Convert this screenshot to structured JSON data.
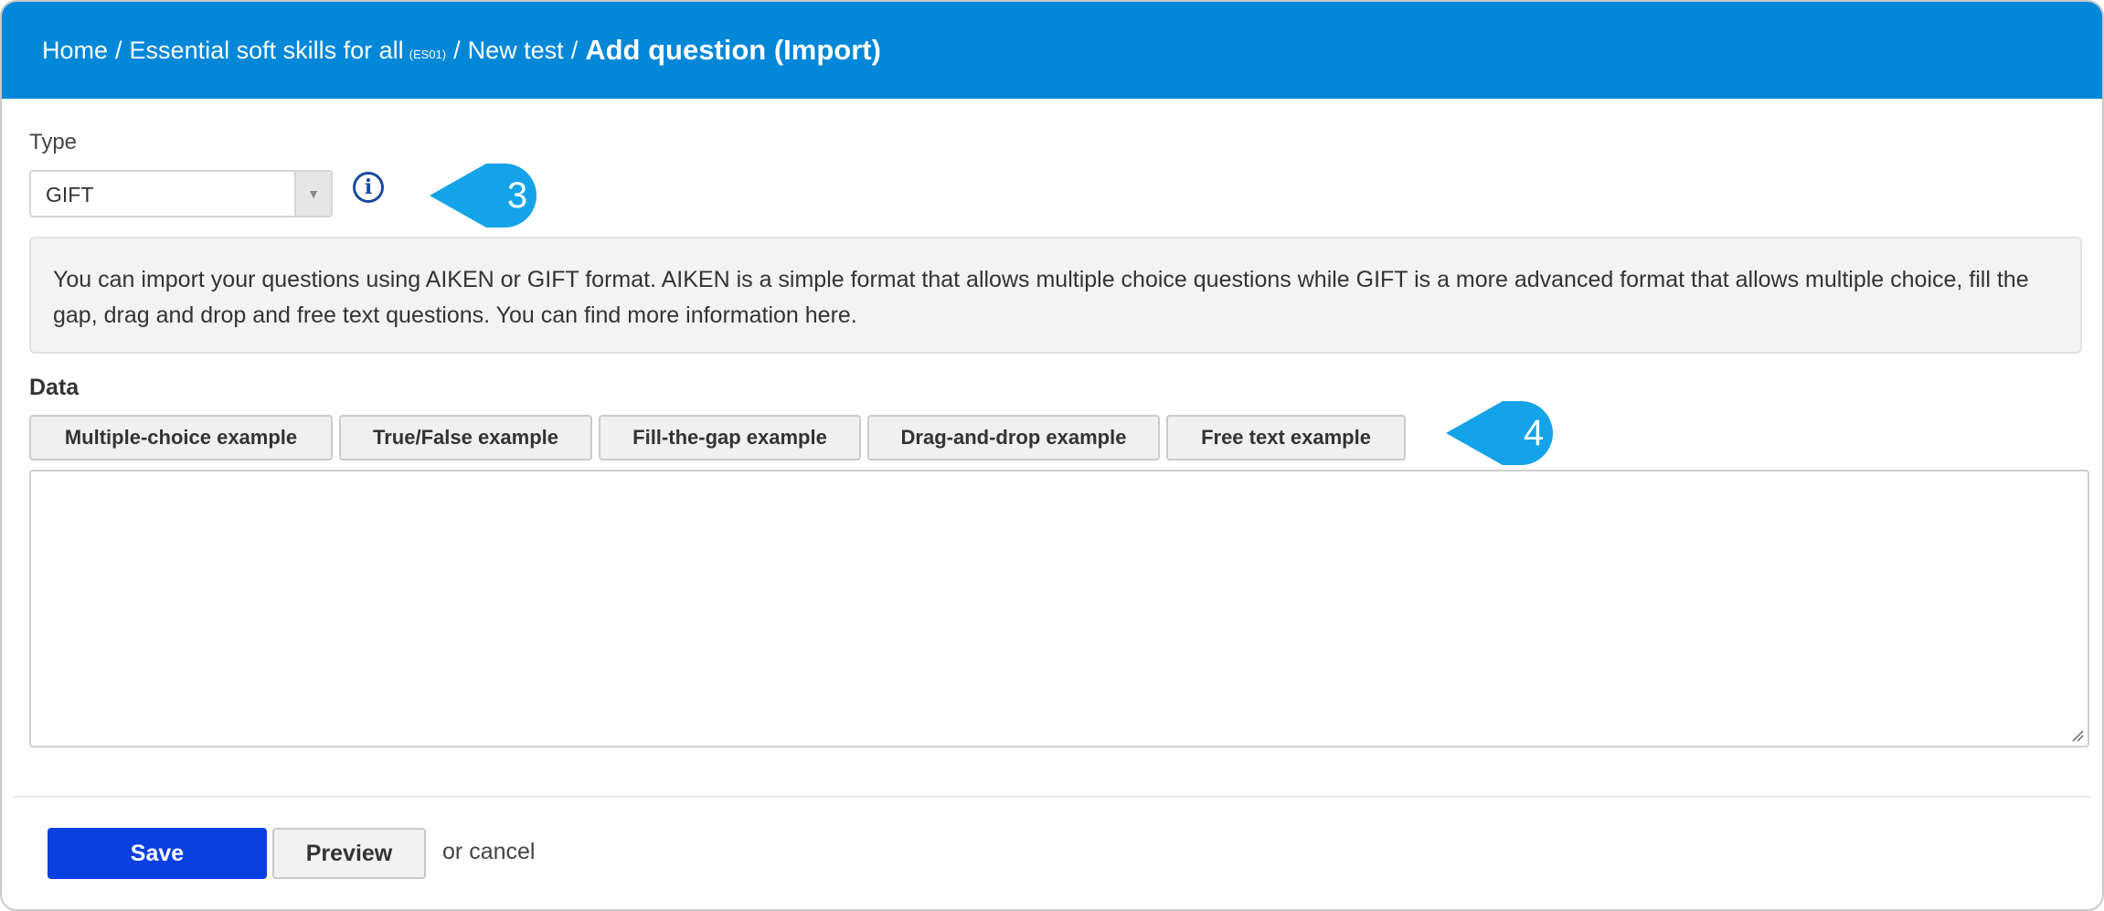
{
  "breadcrumb": {
    "home": "Home",
    "course": "Essential soft skills for all",
    "course_code": "(ES01)",
    "test": "New test",
    "current": "Add question (Import)"
  },
  "type_field": {
    "label": "Type",
    "selected": "GIFT"
  },
  "callouts": {
    "type": "3",
    "examples": "4"
  },
  "info_text": "You can import your questions using AIKEN or GIFT format. AIKEN is a simple format that allows multiple choice questions while GIFT is a more advanced format that allows multiple choice, fill the gap, drag and drop and free text questions. You can find more information here.",
  "data_field": {
    "label": "Data",
    "examples": [
      "Multiple-choice example",
      "True/False example",
      "Fill-the-gap example",
      "Drag-and-drop example",
      "Free text example"
    ],
    "value": ""
  },
  "actions": {
    "save": "Save",
    "preview": "Preview",
    "or": "or",
    "cancel": "cancel"
  },
  "colors": {
    "header_bg": "#0087d8",
    "callout": "#14a3e8",
    "save_bg": "#0a3fe0",
    "info_icon": "#1a4a9c"
  },
  "icons": {
    "info": "info-circle-icon",
    "dropdown": "caret-down-icon",
    "resize": "resize-grip-icon"
  }
}
